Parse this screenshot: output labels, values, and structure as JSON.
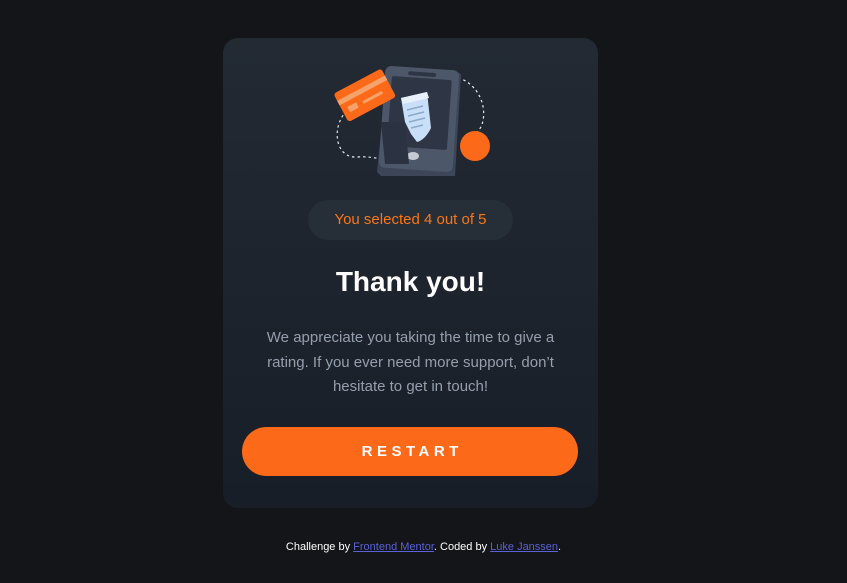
{
  "card": {
    "selected_text": "You selected 4 out of 5",
    "title": "Thank you!",
    "message": "We appreciate you taking the time to give a rating. If you ever need more support, don’t hesitate to get in touch!",
    "restart_label": "RESTART",
    "rating_selected": 4,
    "rating_max": 5
  },
  "attribution": {
    "prefix": "Challenge by ",
    "link1_text": "Frontend Mentor",
    "middle": ". Coded by ",
    "link2_text": "Luke Janssen",
    "suffix": "."
  },
  "colors": {
    "background": "#131518",
    "card": "#212832",
    "accent": "#fc7614",
    "button": "#fc6a19",
    "text_muted": "#969fad",
    "link": "#5a62d4"
  },
  "icons": {
    "illustration": "phone-receipt-card-illustration"
  }
}
